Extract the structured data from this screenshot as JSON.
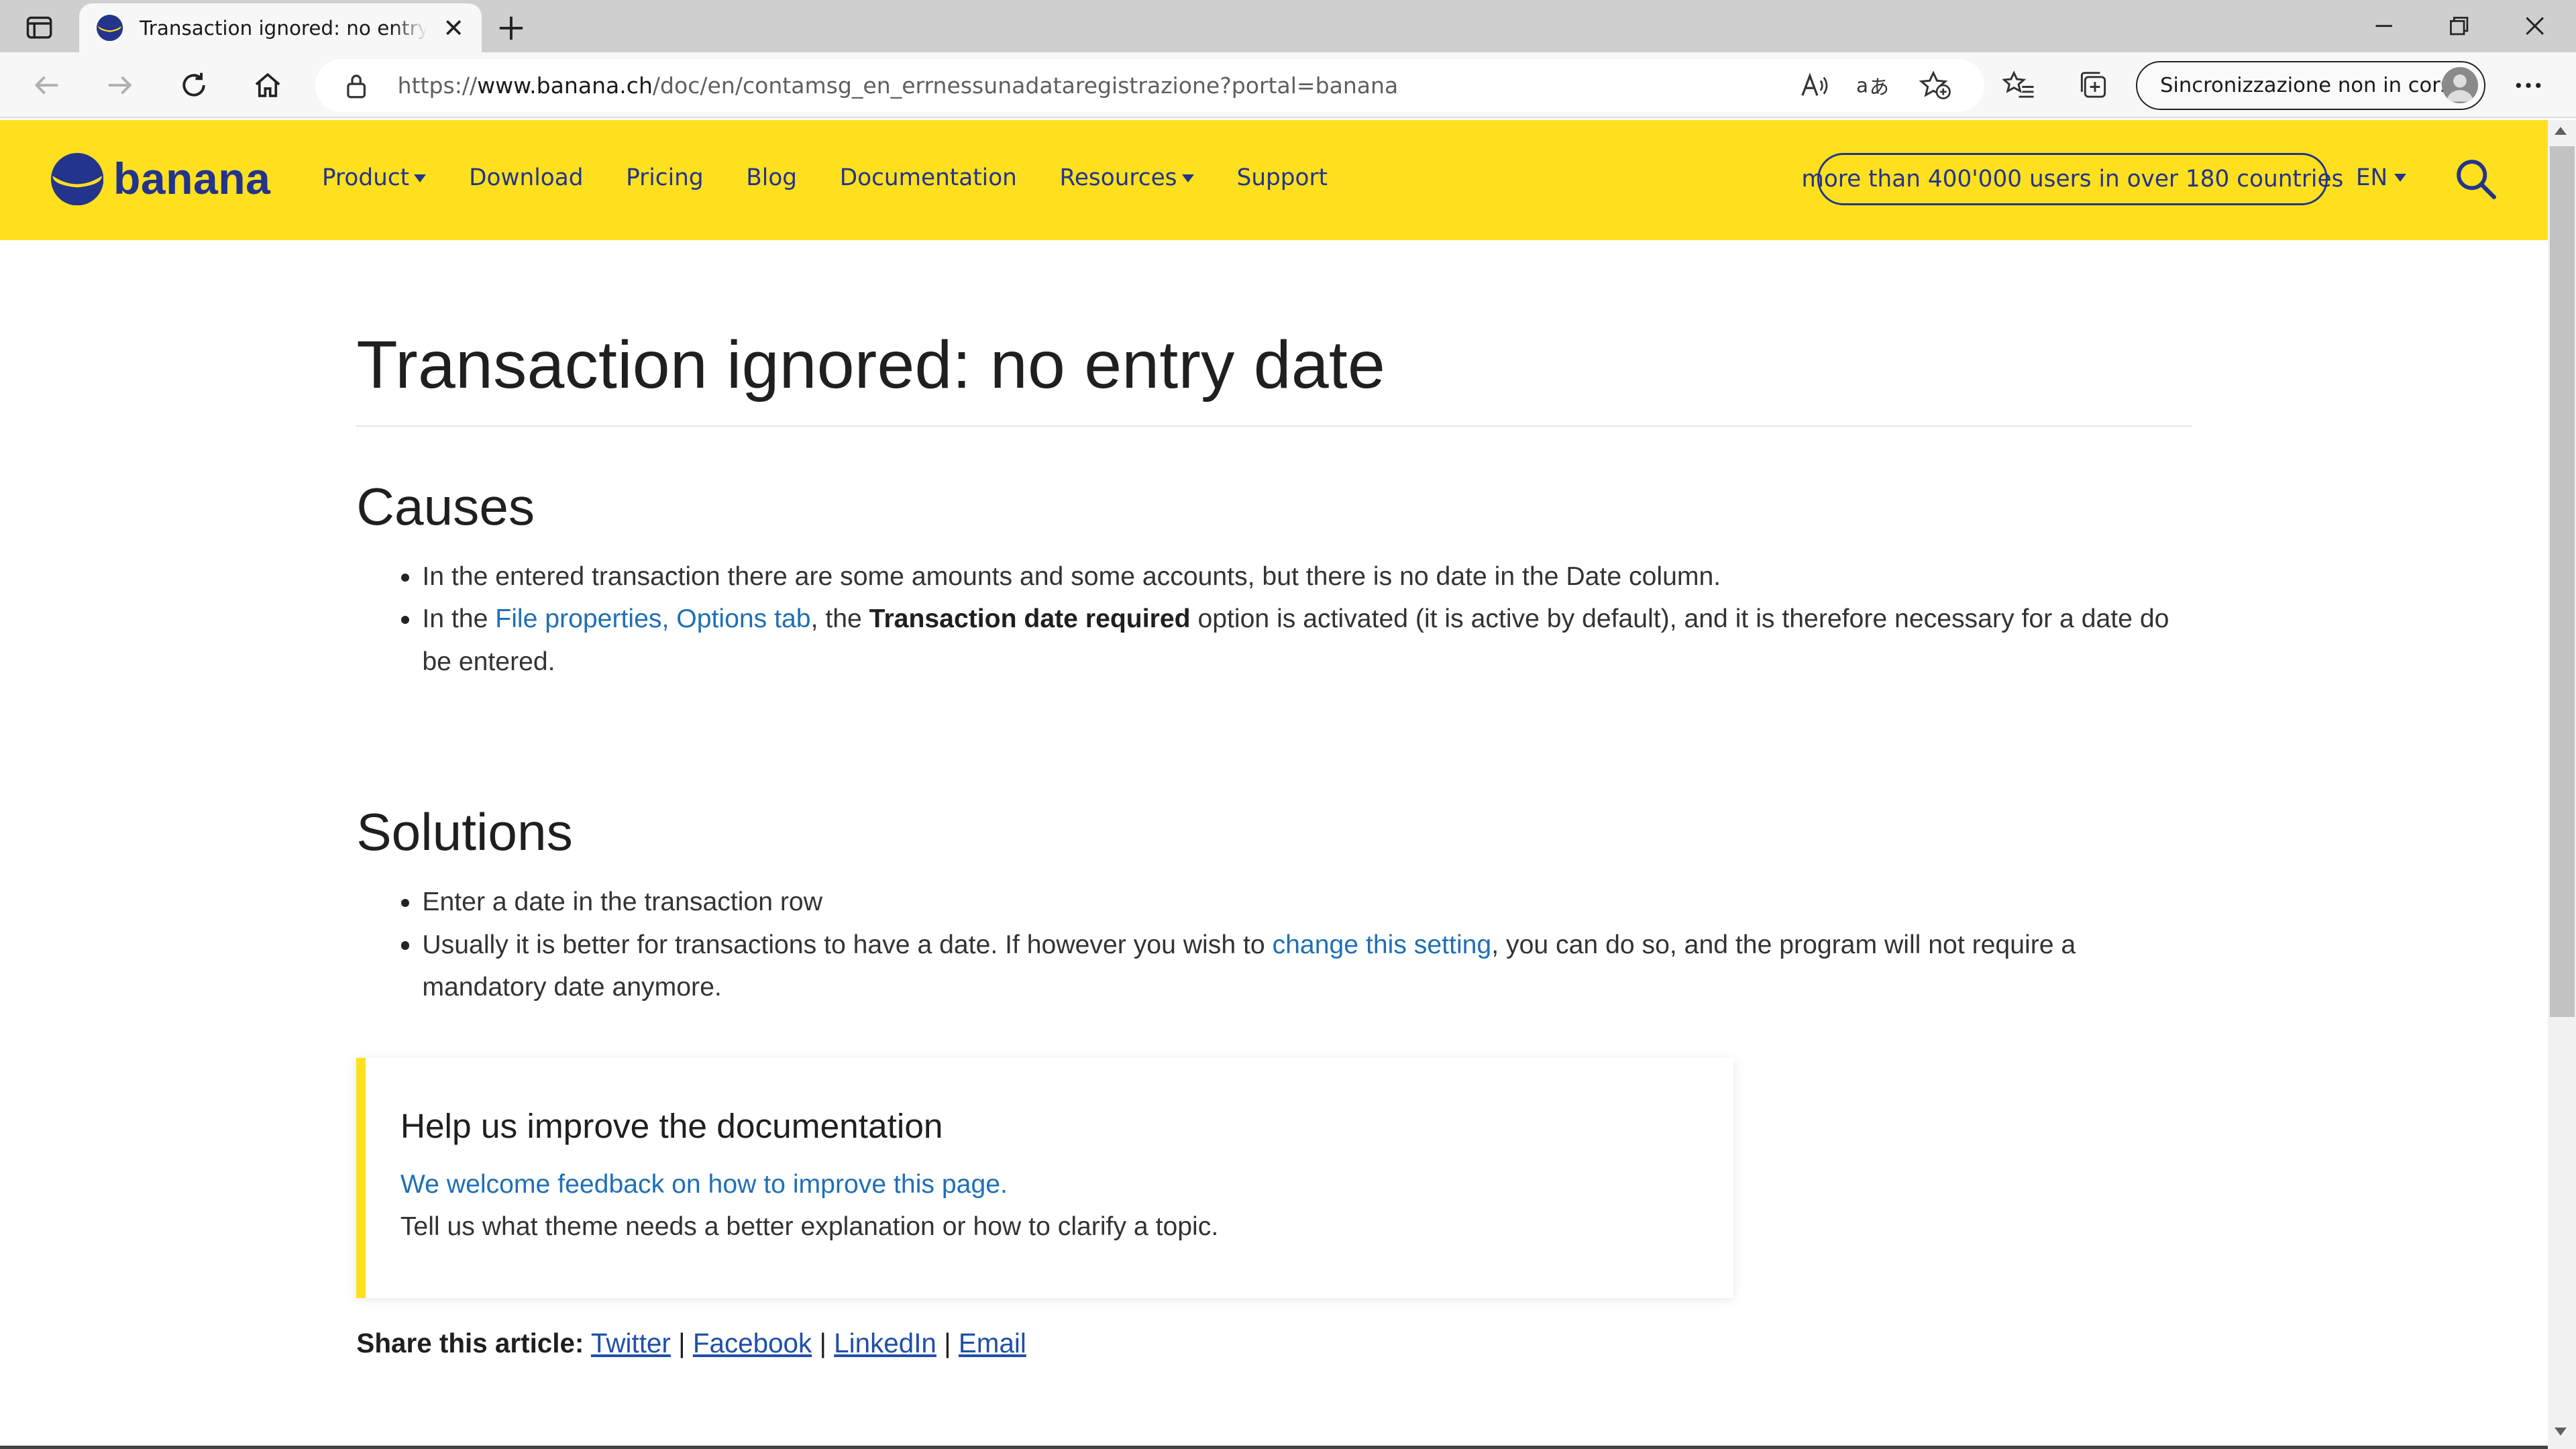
{
  "browser": {
    "tab_title": "Transaction ignored: no entry date",
    "url_prefix": "https://",
    "url_host": "www.banana.ch",
    "url_path": "/doc/en/contamsg_en_errnessunadataregistrazione?portal=banana",
    "sync_label": "Sincronizzazione non in corso"
  },
  "site": {
    "logo_text": "banana",
    "nav": [
      "Product",
      "Download",
      "Pricing",
      "Blog",
      "Documentation",
      "Resources",
      "Support"
    ],
    "users_pill": "more than 400'000 users in over 180 countries",
    "language": "EN"
  },
  "article": {
    "title": "Transaction ignored: no entry date",
    "causes_heading": "Causes",
    "cause1": "In the entered transaction there are some amounts and some accounts, but there is no date in the Date column.",
    "cause2_pre": "In the ",
    "cause2_link": "File properties, Options tab",
    "cause2_mid": ", the ",
    "cause2_bold": "Transaction date required",
    "cause2_post": " option is activated (it is active by default), and it is therefore necessary for a date do be entered.",
    "solutions_heading": "Solutions",
    "solution1": "Enter a date in the transaction row",
    "solution2_pre": "Usually it is better for transactions to have a date. If however you wish to ",
    "solution2_link": "change this setting",
    "solution2_post": ", you can do so, and the program will not require a mandatory date anymore."
  },
  "feedback": {
    "title": "Help us improve the documentation",
    "link": "We welcome feedback on how to improve this page.",
    "text": "Tell us what theme needs a better explanation or how to clarify a topic."
  },
  "share": {
    "label": "Share this article:",
    "links": [
      "Twitter",
      "Facebook",
      "LinkedIn",
      "Email"
    ],
    "separator": "|"
  },
  "colors": {
    "brand_yellow": "#ffe01f",
    "brand_blue": "#23348c",
    "link_blue": "#1f6fb5"
  }
}
